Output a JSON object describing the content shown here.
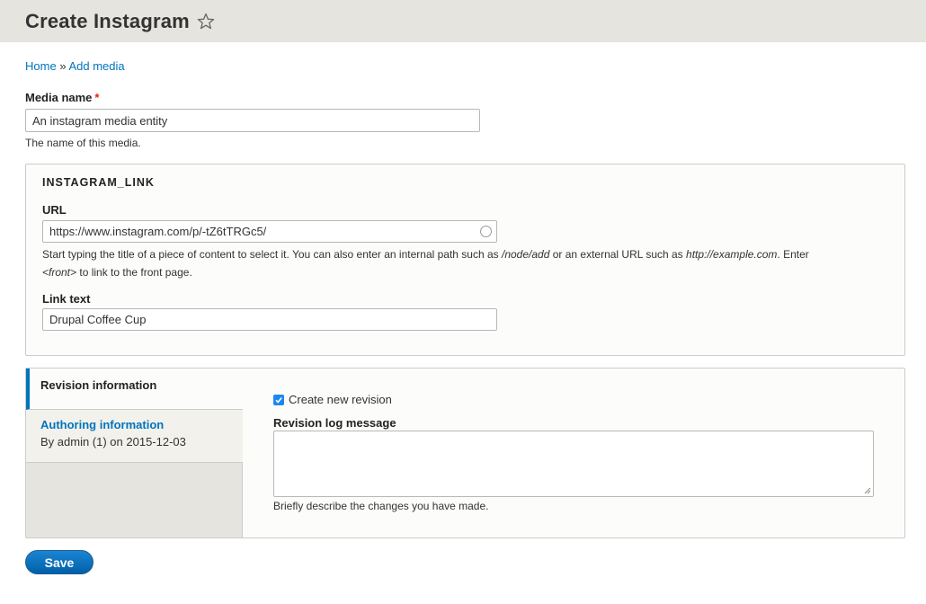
{
  "header": {
    "title": "Create Instagram"
  },
  "breadcrumb": {
    "home": "Home",
    "separator": "»",
    "add_media": "Add media"
  },
  "media_name": {
    "label": "Media name",
    "required_marker": "*",
    "value": "An instagram media entity",
    "description": "The name of this media."
  },
  "instagram_link": {
    "legend": "INSTAGRAM_LINK",
    "url": {
      "label": "URL",
      "value": "https://www.instagram.com/p/-tZ6tTRGc5/",
      "desc_1": "Start typing the title of a piece of content to select it. You can also enter an internal path such as ",
      "desc_node_add": "/node/add",
      "desc_2": " or an external URL such as ",
      "desc_example": "http://example.com",
      "desc_3": ". Enter ",
      "desc_front": "<front>",
      "desc_4": " to link to the front page."
    },
    "link_text": {
      "label": "Link text",
      "value": "Drupal Coffee Cup"
    }
  },
  "vertical_tabs": {
    "revision_tab": "Revision information",
    "authoring_tab": {
      "title": "Authoring information",
      "summary": "By admin (1) on 2015-12-03"
    },
    "create_revision": {
      "label": "Create new revision",
      "checked": true
    },
    "log_message": {
      "label": "Revision log message",
      "value": "",
      "description": "Briefly describe the changes you have made."
    }
  },
  "actions": {
    "save": "Save"
  },
  "colors": {
    "link": "#0074bd",
    "header_bg": "#e6e4df",
    "required": "#e62600",
    "button": "#0060a8"
  }
}
